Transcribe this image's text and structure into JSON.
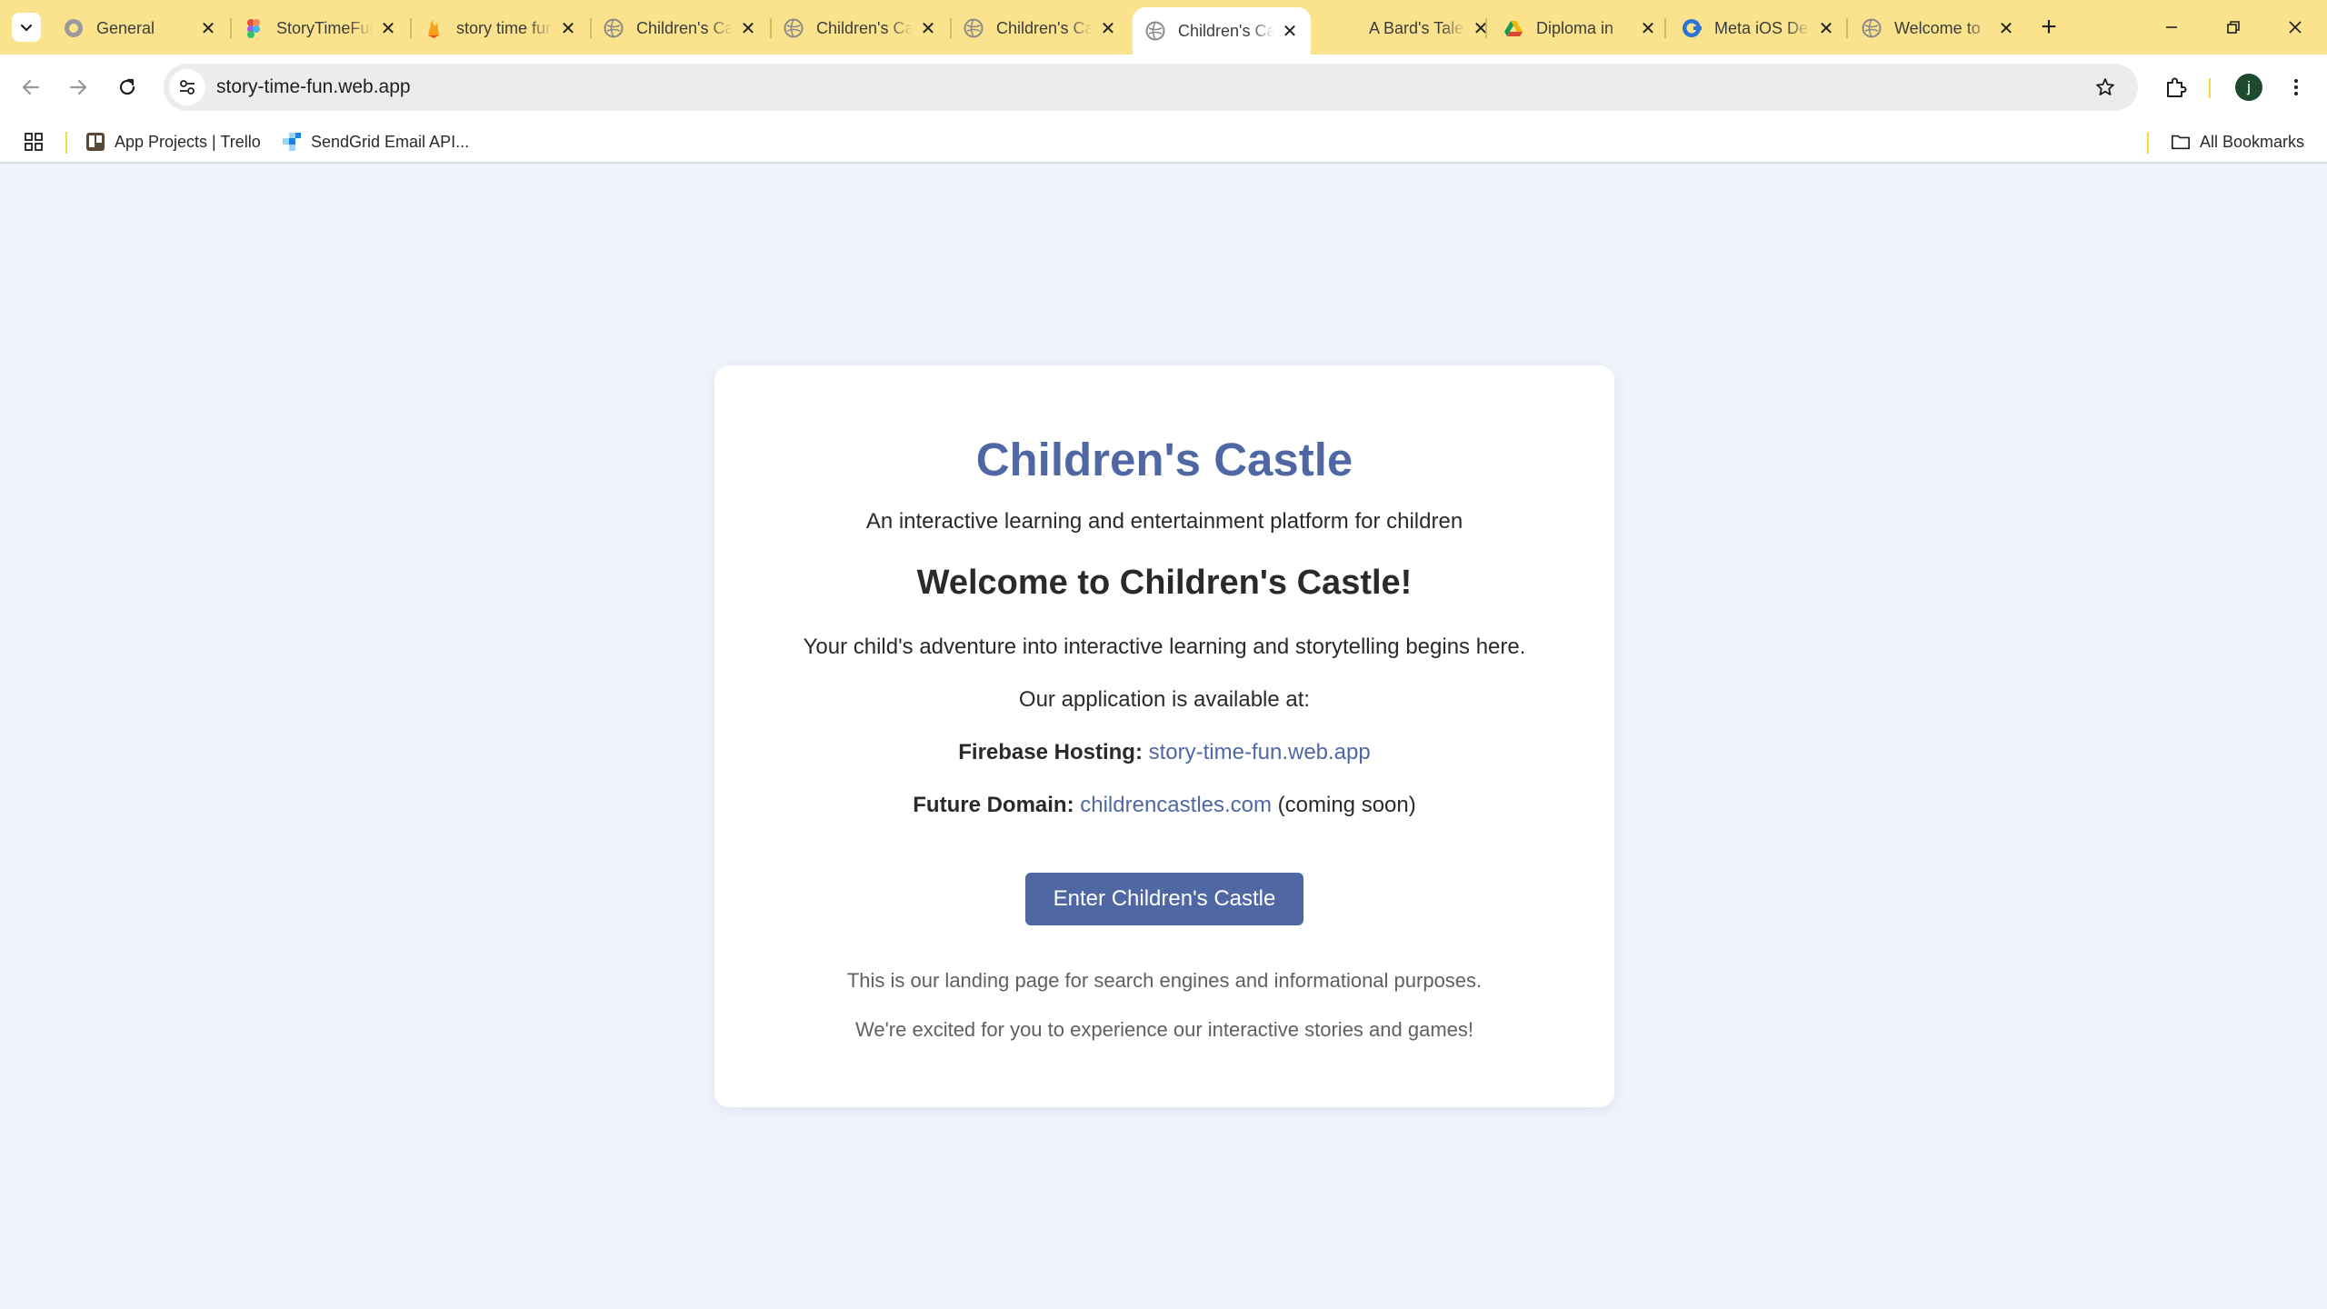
{
  "browser": {
    "tabs": [
      {
        "title": "General",
        "icon": "github-icon",
        "active": false
      },
      {
        "title": "StoryTimeFun",
        "icon": "figma-icon",
        "active": false
      },
      {
        "title": "story time fun",
        "icon": "firebase-icon",
        "active": false
      },
      {
        "title": "Children's Castle",
        "icon": "globe-icon",
        "active": false
      },
      {
        "title": "Children's Castle",
        "icon": "globe-icon",
        "active": false
      },
      {
        "title": "Children's Castle",
        "icon": "globe-icon",
        "active": false
      },
      {
        "title": "Children's Castle",
        "icon": "globe-icon",
        "active": true
      },
      {
        "title": "A Bard's Tale",
        "icon": "",
        "active": false
      },
      {
        "title": "Diploma in",
        "icon": "drive-icon",
        "active": false
      },
      {
        "title": "Meta iOS Dev",
        "icon": "coursera-icon",
        "active": false
      },
      {
        "title": "Welcome to",
        "icon": "globe-icon",
        "active": false
      }
    ],
    "address": "story-time-fun.web.app",
    "avatar_letter": "j",
    "bookmarks": [
      {
        "label": "App Projects | Trello",
        "icon": "trello-icon"
      },
      {
        "label": "SendGrid Email API...",
        "icon": "sendgrid-icon"
      }
    ],
    "all_bookmarks_label": "All Bookmarks"
  },
  "page": {
    "title": "Children's Castle",
    "tagline": "An interactive learning and entertainment platform for children",
    "welcome": "Welcome to Children's Castle!",
    "intro": "Your child's adventure into interactive learning and storytelling begins here.",
    "available": "Our application is available at:",
    "hosting_label": "Firebase Hosting:",
    "hosting_link": "story-time-fun.web.app",
    "domain_label": "Future Domain:",
    "domain_link": "childrencastles.com",
    "domain_note": "(coming soon)",
    "enter_button": "Enter Children's Castle",
    "footer_1": "This is our landing page for search engines and informational purposes.",
    "footer_2": "We're excited for you to experience our interactive stories and games!"
  },
  "colors": {
    "tabstrip": "#fbe38e",
    "accent": "#4f68a4",
    "page_bg": "#f0f4fc"
  }
}
